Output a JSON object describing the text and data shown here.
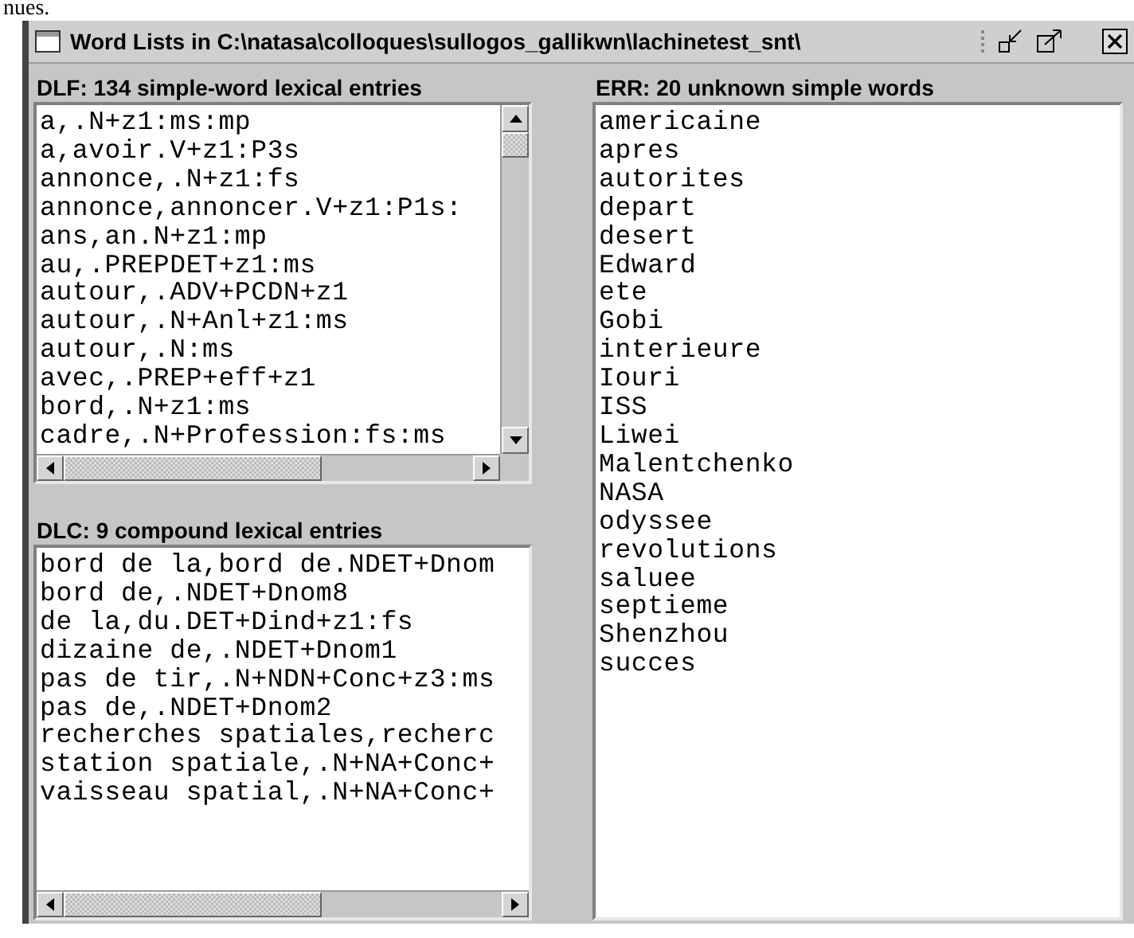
{
  "fragment": "nues.",
  "window": {
    "title": "Word Lists in C:\\natasa\\colloques\\sullogos_gallikwn\\lachinetest_snt\\"
  },
  "panels": [
    {
      "heading": "DLF: 134 simple-word lexical entries",
      "kind": "scroll-both",
      "lines": [
        "a,.N+z1:ms:mp",
        "a,avoir.V+z1:P3s",
        "annonce,.N+z1:fs",
        "annonce,annoncer.V+z1:P1s:",
        "ans,an.N+z1:mp",
        "au,.PREPDET+z1:ms",
        "autour,.ADV+PCDN+z1",
        "autour,.N+Anl+z1:ms",
        "autour,.N:ms",
        "avec,.PREP+eff+z1",
        "bord,.N+z1:ms",
        "cadre,.N+Profession:fs:ms"
      ]
    },
    {
      "heading": "DLC: 9 compound lexical entries",
      "kind": "scroll-h",
      "lines": [
        "bord de la,bord de.NDET+Dnom",
        "bord de,.NDET+Dnom8",
        "de la,du.DET+Dind+z1:fs",
        "dizaine de,.NDET+Dnom1",
        "pas de tir,.N+NDN+Conc+z3:ms",
        "pas de,.NDET+Dnom2",
        "recherches spatiales,recherc",
        "station spatiale,.N+NA+Conc+",
        "vaisseau spatial,.N+NA+Conc+"
      ]
    },
    {
      "heading": "ERR: 20 unknown simple words",
      "kind": "plain",
      "lines": [
        "americaine",
        "apres",
        "autorites",
        "depart",
        "desert",
        "Edward",
        "ete",
        "Gobi",
        "interieure",
        "Iouri",
        "ISS",
        "Liwei",
        "Malentchenko",
        "NASA",
        "odyssee",
        "revolutions",
        "saluee",
        "septieme",
        "Shenzhou",
        "succes"
      ]
    }
  ]
}
